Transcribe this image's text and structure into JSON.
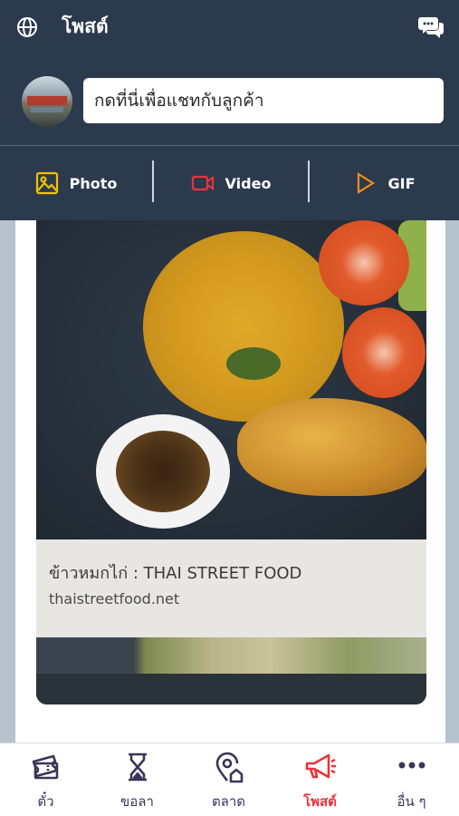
{
  "header": {
    "title": "โพสต์",
    "globe_icon": "globe-icon",
    "chat_icon": "chat-bubbles-icon"
  },
  "composer": {
    "placeholder": "กดที่นี่เพื่อแชทกับลูกค้า"
  },
  "media_bar": {
    "photo_label": "Photo",
    "video_label": "Video",
    "gif_label": "GIF",
    "photo_color": "#f2c200",
    "video_color": "#e8343b",
    "gif_color": "#f08c1a"
  },
  "post": {
    "caption_title": "ข้าวหมกไก่ : THAI STREET FOOD",
    "caption_url": "thaistreetfood.net"
  },
  "bottom_nav": {
    "items": [
      {
        "label": "ตั๋ว",
        "icon": "ticket-icon"
      },
      {
        "label": "ขอลา",
        "icon": "hourglass-icon"
      },
      {
        "label": "ตลาด",
        "icon": "market-pin-icon"
      },
      {
        "label": "โพสต์",
        "icon": "megaphone-icon"
      },
      {
        "label": "อื่น ๆ",
        "icon": "more-dots-icon"
      }
    ],
    "active_index": 3,
    "active_color": "#e8343b",
    "inactive_color": "#3b3558"
  },
  "theme": {
    "header_bg": "#2c3a4e",
    "page_bg": "#b7c2cf"
  }
}
